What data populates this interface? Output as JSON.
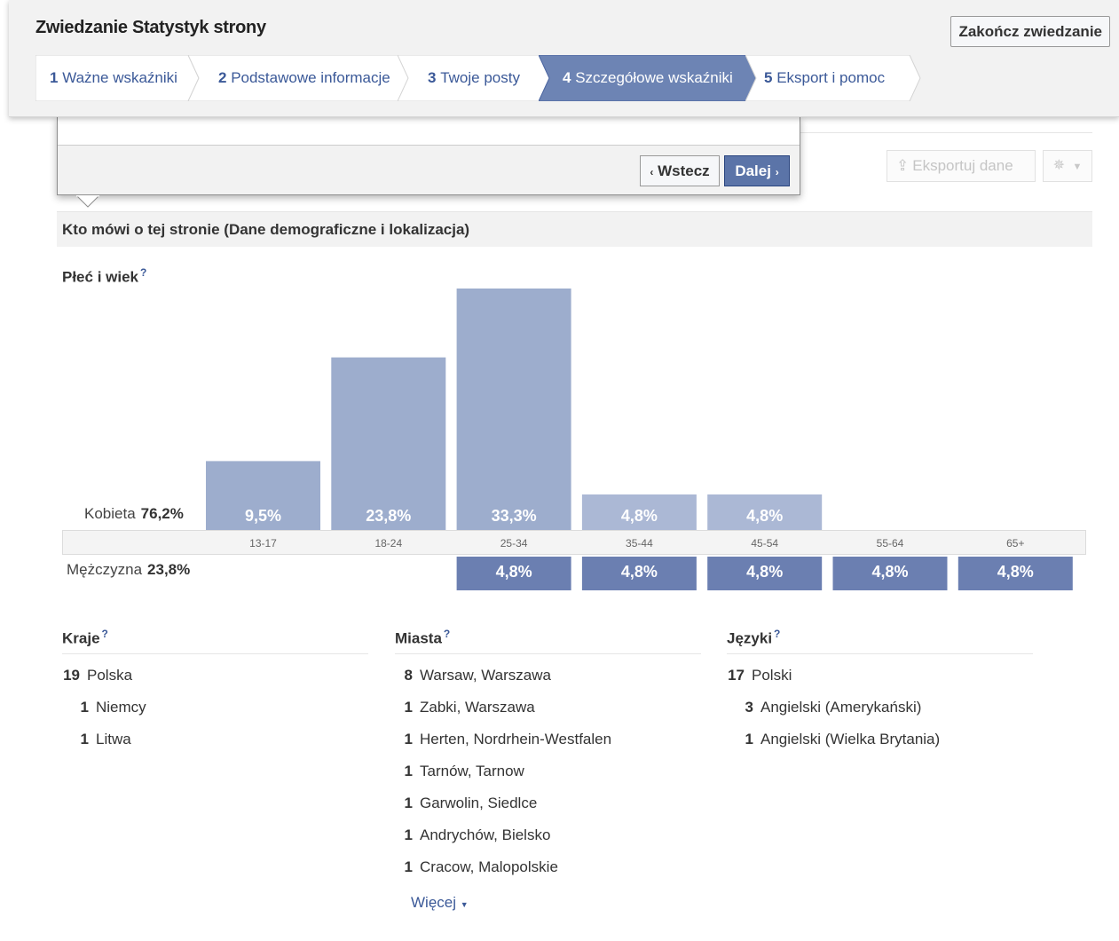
{
  "tour": {
    "title": "Zwiedzanie Statystyk strony",
    "end_button": "Zakończ zwiedzanie",
    "steps": [
      {
        "num": "1",
        "label": "Ważne wskaźniki"
      },
      {
        "num": "2",
        "label": "Podstawowe informacje"
      },
      {
        "num": "3",
        "label": "Twoje posty"
      },
      {
        "num": "4",
        "label": "Szczegółowe wskaźniki"
      },
      {
        "num": "5",
        "label": "Eksport i pomoc"
      }
    ],
    "active_step": 4
  },
  "popover": {
    "back_label": "Wstecz",
    "next_label": "Dalej"
  },
  "toolbar": {
    "export_label": "Eksportuj dane",
    "export_icon": "upload-icon",
    "settings_icon": "gear-icon"
  },
  "section": {
    "title": "Kto mówi o tej stronie (Dane demograficzne i lokalizacja)"
  },
  "age_gender": {
    "title": "Płeć i wiek",
    "help": "?",
    "female_label": "Kobieta",
    "female_total": "76,2%",
    "male_label": "Mężczyzna",
    "male_total": "23,8%"
  },
  "chart_data": {
    "type": "bar",
    "categories": [
      "13-17",
      "18-24",
      "25-34",
      "35-44",
      "45-54",
      "55-64",
      "65+"
    ],
    "series": [
      {
        "name": "Kobieta",
        "values": [
          9.5,
          23.8,
          33.3,
          4.8,
          4.8,
          null,
          null
        ],
        "labels": [
          "9,5%",
          "23,8%",
          "33,3%",
          "4,8%",
          "4,8%",
          "",
          ""
        ],
        "color": "#9dadcd"
      },
      {
        "name": "Mężczyzna",
        "values": [
          null,
          null,
          4.8,
          4.8,
          4.8,
          4.8,
          4.8
        ],
        "labels": [
          "",
          "",
          "4,8%",
          "4,8%",
          "4,8%",
          "4,8%",
          "4,8%"
        ],
        "color": "#6b7fb1"
      }
    ],
    "light_color": "#abb8d5"
  },
  "countries": {
    "title": "Kraje",
    "help": "?",
    "items": [
      {
        "count": "19",
        "name": "Polska"
      },
      {
        "count": "1",
        "name": "Niemcy"
      },
      {
        "count": "1",
        "name": "Litwa"
      }
    ]
  },
  "cities": {
    "title": "Miasta",
    "help": "?",
    "items": [
      {
        "count": "8",
        "name": "Warsaw, Warszawa"
      },
      {
        "count": "1",
        "name": "Zabki, Warszawa"
      },
      {
        "count": "1",
        "name": "Herten, Nordrhein-Westfalen"
      },
      {
        "count": "1",
        "name": "Tarnów, Tarnow"
      },
      {
        "count": "1",
        "name": "Garwolin, Siedlce"
      },
      {
        "count": "1",
        "name": "Andrychów, Bielsko"
      },
      {
        "count": "1",
        "name": "Cracow, Malopolskie"
      }
    ],
    "more_label": "Więcej"
  },
  "languages": {
    "title": "Języki",
    "help": "?",
    "items": [
      {
        "count": "17",
        "name": "Polski"
      },
      {
        "count": "3",
        "name": "Angielski (Amerykański)"
      },
      {
        "count": "1",
        "name": "Angielski (Wielka Brytania)"
      }
    ]
  }
}
